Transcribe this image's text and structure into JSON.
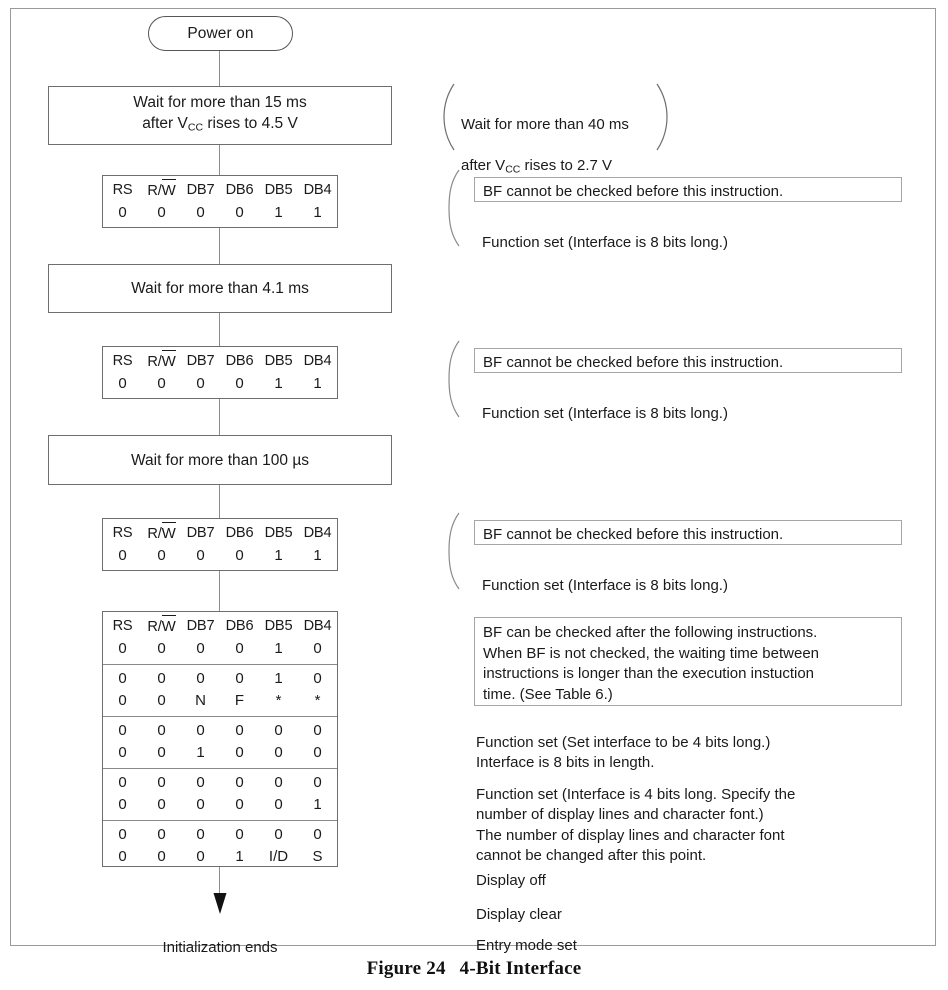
{
  "figure": {
    "caption_number": "Figure 24",
    "caption_title": "4-Bit Interface"
  },
  "flow": {
    "start_label": "Power on",
    "end_label": "Initialization ends",
    "bit_header": [
      "RS",
      "R/W",
      "DB7",
      "DB6",
      "DB5",
      "DB4"
    ],
    "steps": [
      {
        "id": "wait-15ms",
        "type": "wait",
        "line1": "Wait for more than 15 ms",
        "line2_pre": "after V",
        "line2_sub": "CC",
        "line2_post": " rises to 4.5 V"
      },
      {
        "id": "instruction-1",
        "type": "instruction",
        "rows": [
          [
            "0",
            "0",
            "0",
            "0",
            "1",
            "1"
          ]
        ]
      },
      {
        "id": "wait-4p1ms",
        "type": "wait",
        "line1": "Wait for more than 4.1 ms"
      },
      {
        "id": "instruction-2",
        "type": "instruction",
        "rows": [
          [
            "0",
            "0",
            "0",
            "0",
            "1",
            "1"
          ]
        ]
      },
      {
        "id": "wait-100us",
        "type": "wait",
        "line1": "Wait for more than 100 µs"
      },
      {
        "id": "instruction-3",
        "type": "instruction",
        "rows": [
          [
            "0",
            "0",
            "0",
            "0",
            "1",
            "1"
          ]
        ]
      }
    ],
    "final_table": {
      "header": [
        "RS",
        "R/W",
        "DB7",
        "DB6",
        "DB5",
        "DB4"
      ],
      "groups": [
        {
          "rows": [
            [
              "0",
              "0",
              "0",
              "0",
              "1",
              "0"
            ]
          ]
        },
        {
          "rows": [
            [
              "0",
              "0",
              "0",
              "0",
              "1",
              "0"
            ],
            [
              "0",
              "0",
              "N",
              "F",
              "*",
              "*"
            ]
          ]
        },
        {
          "rows": [
            [
              "0",
              "0",
              "0",
              "0",
              "0",
              "0"
            ],
            [
              "0",
              "0",
              "1",
              "0",
              "0",
              "0"
            ]
          ]
        },
        {
          "rows": [
            [
              "0",
              "0",
              "0",
              "0",
              "0",
              "0"
            ],
            [
              "0",
              "0",
              "0",
              "0",
              "0",
              "1"
            ]
          ]
        },
        {
          "rows": [
            [
              "0",
              "0",
              "0",
              "0",
              "0",
              "0"
            ],
            [
              "0",
              "0",
              "0",
              "1",
              "I/D",
              "S"
            ]
          ]
        }
      ]
    }
  },
  "notes": {
    "vcc_note": {
      "line1": "Wait for more than 40 ms",
      "line2_pre": "after V",
      "line2_sub": "CC",
      "line2_post": " rises to 2.7 V"
    },
    "bf_cannot": "BF cannot be checked before this instruction.",
    "function_set_8bit": "Function set  (Interface is 8 bits long.)",
    "bf_can_box": "BF can be checked after the following instructions.\nWhen BF is not checked, the waiting time between\ninstructions is longer than the execution instuction\ntime.  (See Table 6.)",
    "function_set_4bit_set": "Function set  (Set interface to be 4 bits long.)\nInterface is 8 bits in length.",
    "function_set_4bit_spec": "Function set  (Interface is 4 bits long.  Specify the\nnumber of display lines and character font.)\nThe number of display lines and character font\ncannot be changed after this point.",
    "display_off": "Display off",
    "display_clear": "Display clear",
    "entry_mode_set": "Entry mode set"
  },
  "colors": {
    "frame": "#9a9a9a",
    "box_border": "#6e6e6e",
    "note_border": "#a6a6a6",
    "line": "#8d8d8d",
    "text": "#1a1a1a"
  }
}
